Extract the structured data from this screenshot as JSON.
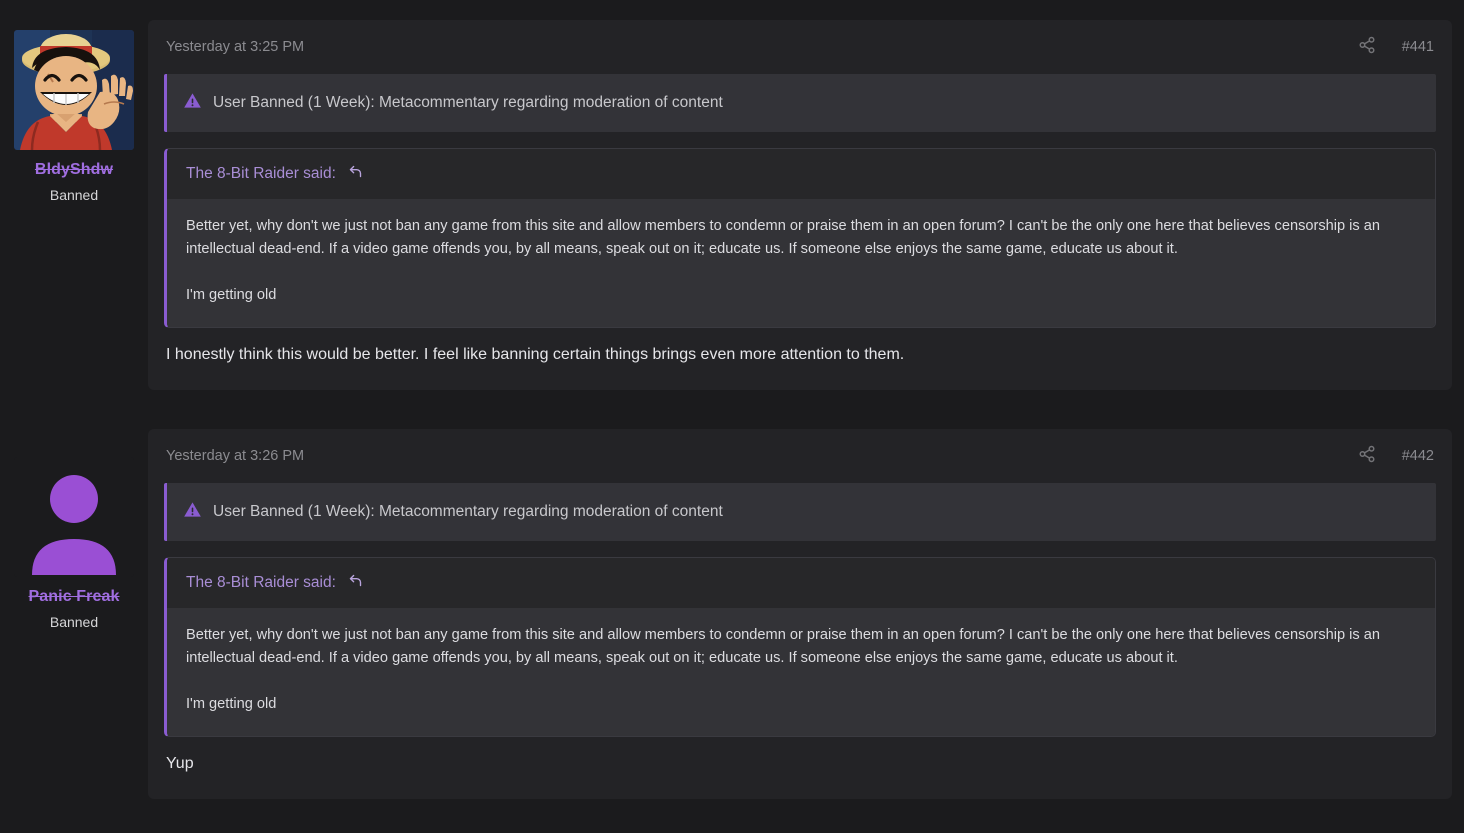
{
  "theme": {
    "page_background": "#1b1b1d",
    "post_background": "#232326",
    "banner_background": "#333338",
    "accent_purple": "#8a5cd1",
    "username_purple": "#a06ee0",
    "quote_head_background": "#272729",
    "quote_body_background": "#333337",
    "muted_text": "#8b8b90"
  },
  "posts": [
    {
      "author": {
        "username": "BldyShdw",
        "user_title": "Banned",
        "avatar_type": "image",
        "avatar_alt": "anime-character-avatar"
      },
      "date": "Yesterday at 3:25 PM",
      "post_number": "#441",
      "share_icon": "share-icon",
      "moderation_notice": {
        "icon": "warning-triangle-icon",
        "text": "User Banned (1 Week): Metacommentary regarding moderation of content"
      },
      "quote": {
        "attribution": "The 8-Bit Raider said:",
        "reply_icon": "reply-arrow-icon",
        "paragraphs": [
          "Better yet, why don't we just not ban any game from this site and allow members to condemn or praise them in an open forum? I can't be the only one here that believes censorship is an intellectual dead-end. If a video game offends you, by all means, speak out on it; educate us. If someone else enjoys the same game, educate us about it.",
          "I'm getting old"
        ]
      },
      "message": "I honestly think this would be better. I feel like banning certain things brings even more attention to them."
    },
    {
      "author": {
        "username": "Panic Freak",
        "user_title": "Banned",
        "avatar_type": "default",
        "avatar_alt": "default-user-silhouette-avatar"
      },
      "date": "Yesterday at 3:26 PM",
      "post_number": "#442",
      "share_icon": "share-icon",
      "moderation_notice": {
        "icon": "warning-triangle-icon",
        "text": "User Banned (1 Week): Metacommentary regarding moderation of content"
      },
      "quote": {
        "attribution": "The 8-Bit Raider said:",
        "reply_icon": "reply-arrow-icon",
        "paragraphs": [
          "Better yet, why don't we just not ban any game from this site and allow members to condemn or praise them in an open forum? I can't be the only one here that believes censorship is an intellectual dead-end. If a video game offends you, by all means, speak out on it; educate us. If someone else enjoys the same game, educate us about it.",
          "I'm getting old"
        ]
      },
      "message": "Yup"
    }
  ]
}
